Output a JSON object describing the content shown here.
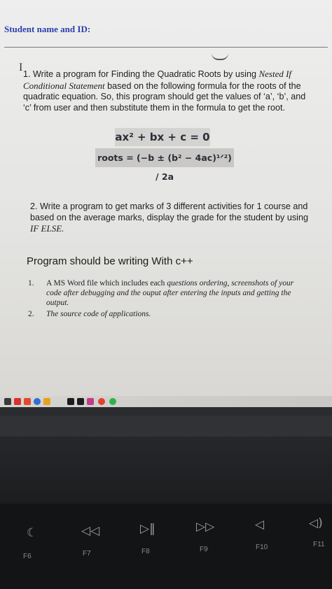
{
  "header": {
    "student_label": "Student name and ID:"
  },
  "question1": {
    "prefix": "1. Write a program for Finding the Quadratic Roots by using ",
    "italic": "Nested If Conditional Statement",
    "rest": " based on the following formula for the roots of the quadratic equation. So, this program should get the values of ‘a’, ‘b’, and ‘c’ from user and then  substitute them in the formula to get the root.",
    "equation": "ax² + bx + c = 0",
    "roots_formula": "roots = (−b ± (b² − 4ac)¹ᐟ²) / 2a"
  },
  "question2": {
    "prefix": "2. Write a program to get marks of 3 different activities for 1 course and based on the average marks,  display the grade for the student by using ",
    "italic": "IF ELSE."
  },
  "language_line": "Program should be writing With c++",
  "requirements": [
    {
      "num": "1.",
      "lead": "A MS Word file which includes each ",
      "text": "questions ordering, screenshots of your code after debugging and the ouput after entering the inputs and getting the output."
    },
    {
      "num": "2.",
      "lead": "",
      "text": "The source code of applications."
    }
  ],
  "function_keys": [
    {
      "icon": "☾",
      "label": "F6"
    },
    {
      "icon": "◁◁",
      "label": "F7"
    },
    {
      "icon": "▷‖",
      "label": "F8"
    },
    {
      "icon": "▷▷",
      "label": "F9"
    },
    {
      "icon": "◁",
      "label": "F10"
    },
    {
      "icon": "◁)",
      "label": "F11"
    }
  ],
  "colors": {
    "student_label": "#2a3fb0",
    "text": "#1e1e1e",
    "keyboard": "#1a1b1d"
  }
}
